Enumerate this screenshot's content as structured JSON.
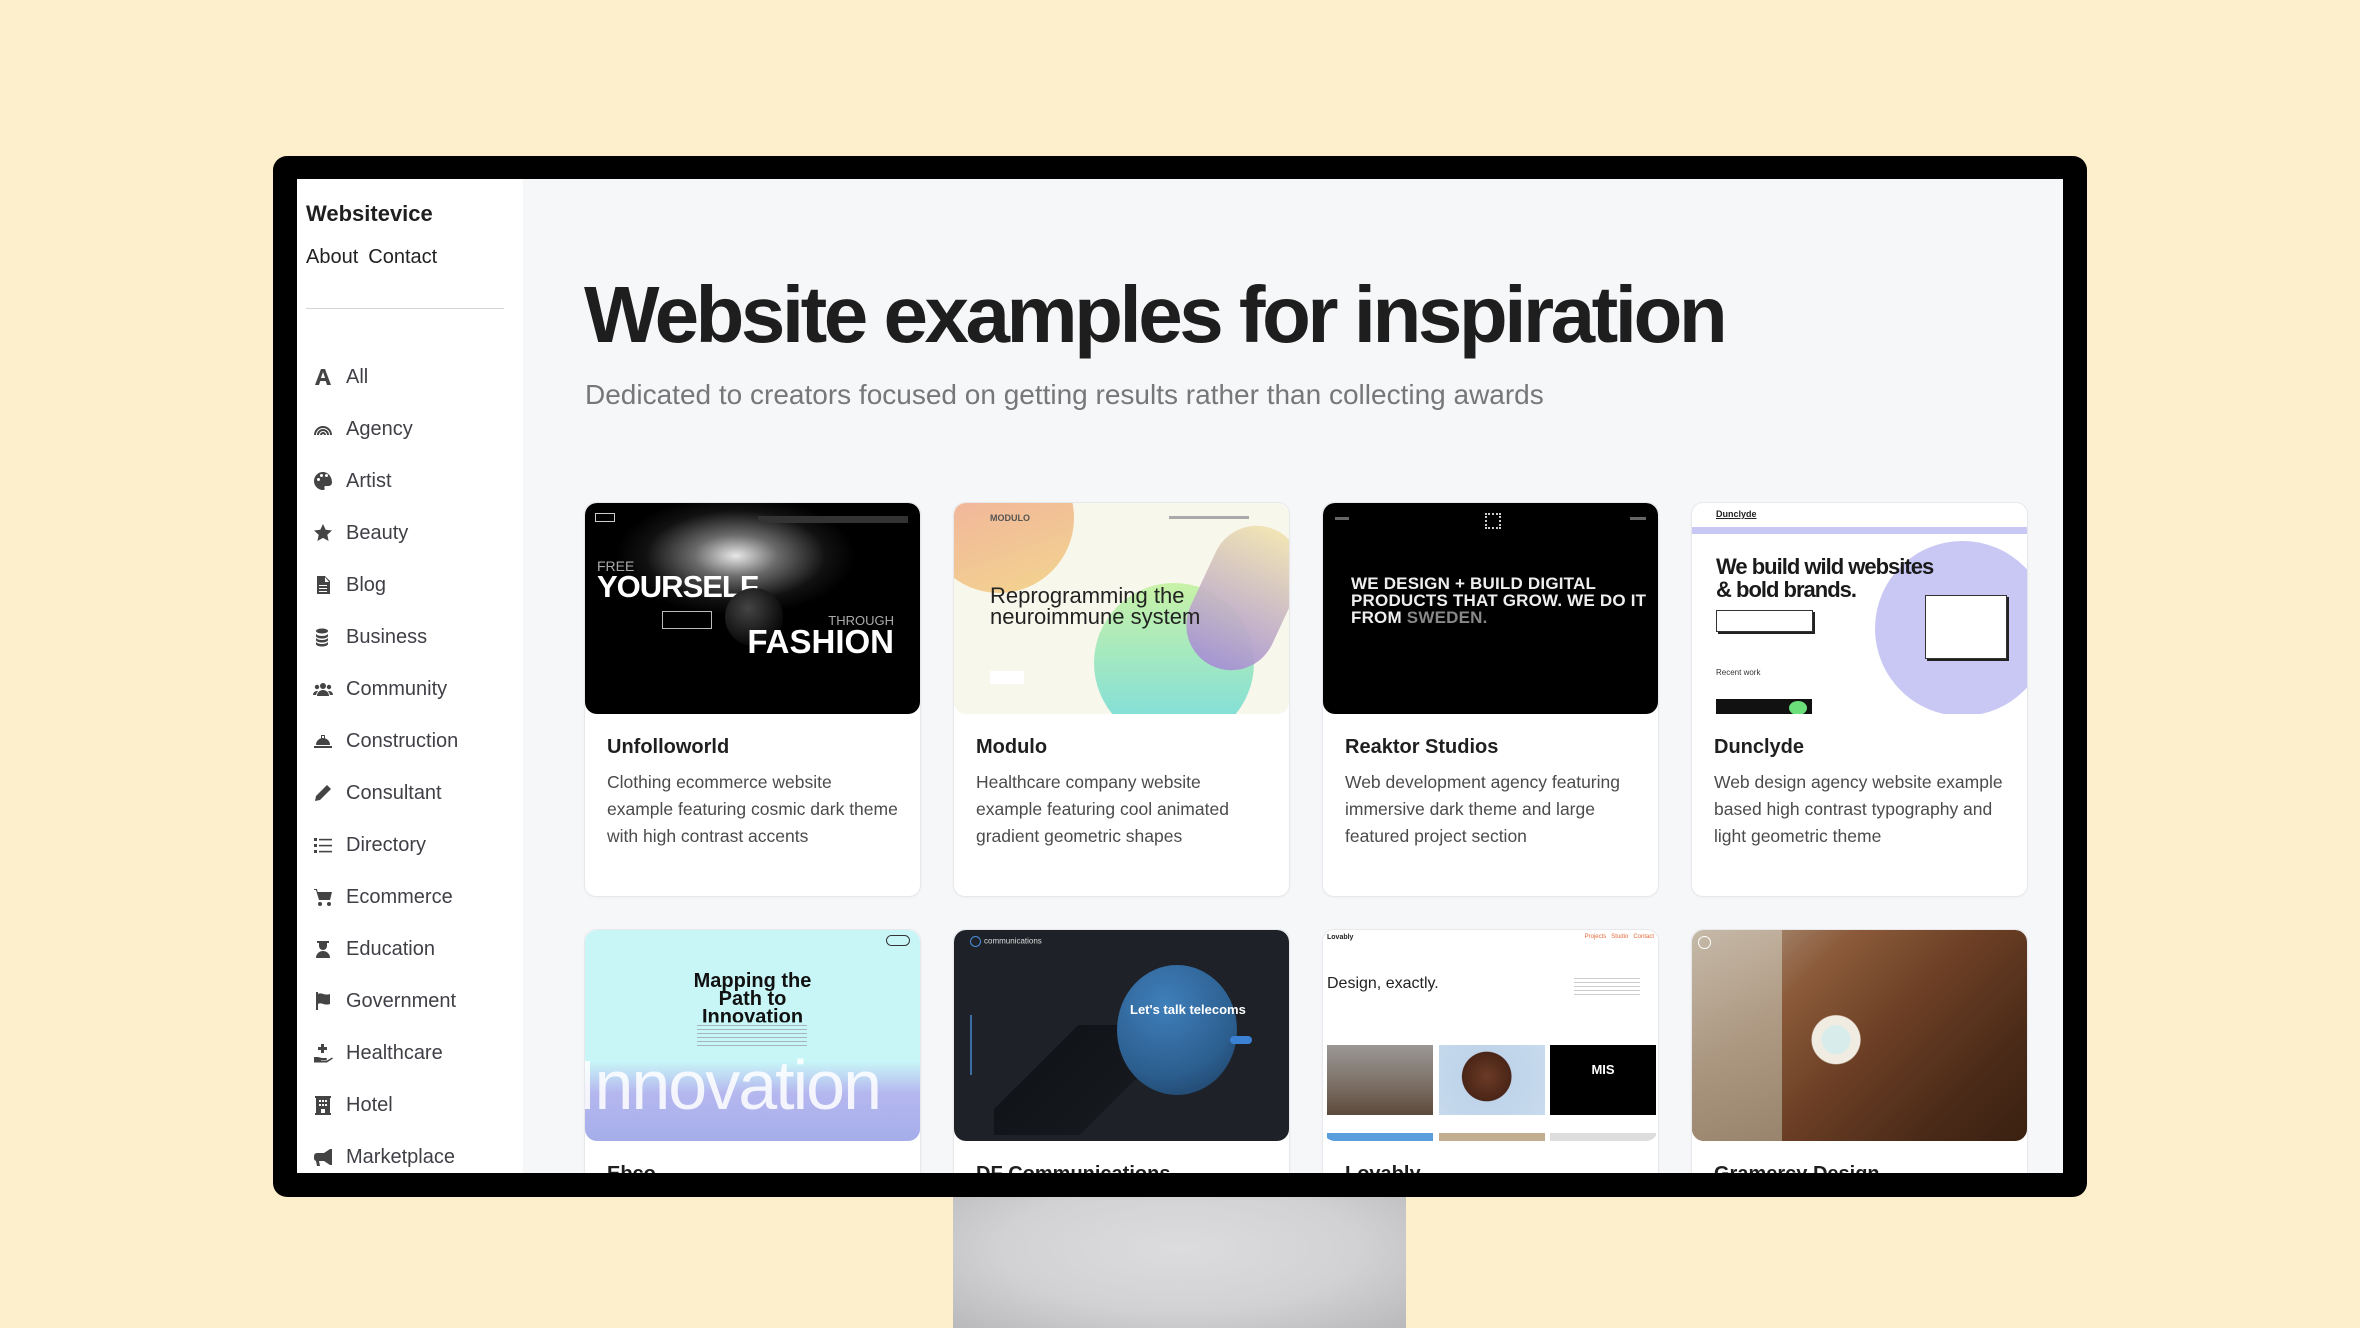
{
  "site": {
    "brand": "Websitevice",
    "top_links": [
      "About",
      "Contact"
    ]
  },
  "sidebar": {
    "categories": [
      {
        "label": "All",
        "icon": "letter-a-icon"
      },
      {
        "label": "Agency",
        "icon": "rainbow-icon"
      },
      {
        "label": "Artist",
        "icon": "palette-icon"
      },
      {
        "label": "Beauty",
        "icon": "star-icon"
      },
      {
        "label": "Blog",
        "icon": "document-icon"
      },
      {
        "label": "Business",
        "icon": "coins-icon"
      },
      {
        "label": "Community",
        "icon": "users-icon"
      },
      {
        "label": "Construction",
        "icon": "hard-hat-icon"
      },
      {
        "label": "Consultant",
        "icon": "pencil-icon"
      },
      {
        "label": "Directory",
        "icon": "list-icon"
      },
      {
        "label": "Ecommerce",
        "icon": "cart-icon"
      },
      {
        "label": "Education",
        "icon": "graduate-icon"
      },
      {
        "label": "Government",
        "icon": "flag-icon"
      },
      {
        "label": "Healthcare",
        "icon": "hand-holding-medical-icon"
      },
      {
        "label": "Hotel",
        "icon": "hotel-icon"
      },
      {
        "label": "Marketplace",
        "icon": "megaphone-icon"
      }
    ]
  },
  "main": {
    "title": "Website examples for inspiration",
    "subtitle": "Dedicated to creators focused on getting results rather than collecting awards"
  },
  "cards": [
    {
      "title": "Unfolloworld",
      "description": "Clothing ecommerce website example featuring cosmic dark theme with high contrast accents",
      "preview": {
        "line1": "FREE",
        "line2": "YOURSELF",
        "line3": "THROUGH",
        "line4": "FASHION"
      }
    },
    {
      "title": "Modulo",
      "description": "Healthcare company website example featuring cool animated gradient geometric shapes",
      "preview": {
        "logo": "MODULO",
        "headline": "Reprogramming the neuroimmune system"
      }
    },
    {
      "title": "Reaktor Studios",
      "description": "Web development agency featuring immersive dark theme and large featured project section",
      "preview": {
        "headline": "WE DESIGN + BUILD DIGITAL PRODUCTS THAT GROW. WE DO IT FROM ",
        "highlight": "SWEDEN."
      }
    },
    {
      "title": "Dunclyde",
      "description": "Web design agency website example based high contrast typography and light geometric theme",
      "preview": {
        "logo": "Dunclyde",
        "headline": "We build wild websites & bold brands.",
        "section": "Recent work"
      }
    },
    {
      "title": "Ebco",
      "description": "",
      "preview": {
        "headline": "Mapping the Path to Innovation",
        "big": "Innovation"
      }
    },
    {
      "title": "DF Communications",
      "description": "",
      "preview": {
        "logo": "communications",
        "headline": "Let's talk telecoms"
      }
    },
    {
      "title": "Lovably",
      "description": "",
      "preview": {
        "logo": "Lovably",
        "nav": "Projects   Studio   Contact",
        "headline": "Design, exactly.",
        "tile": "MIS"
      }
    },
    {
      "title": "Gramercy Design",
      "description": "",
      "preview": {}
    }
  ]
}
